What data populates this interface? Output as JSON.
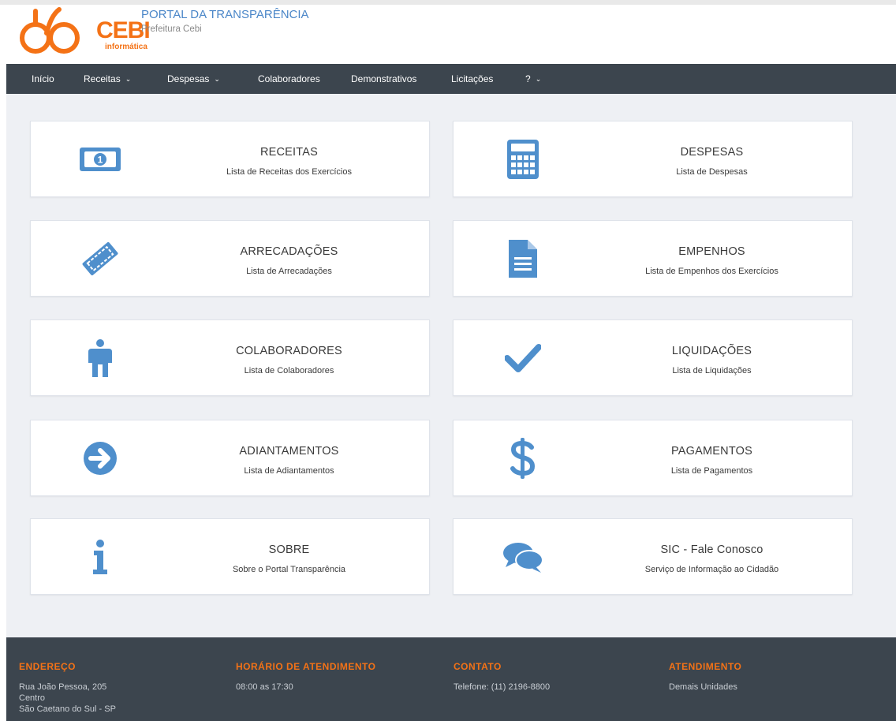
{
  "brand": {
    "logo_text": "CEBI",
    "logo_subtext": "informática",
    "portal_title": "PORTAL DA TRANSPARÊNCIA",
    "portal_subtitle": "Prefeitura Cebi",
    "accent_color": "#f47216",
    "title_color": "#4a86c8"
  },
  "nav": {
    "items": [
      {
        "label": "Início",
        "has_caret": false
      },
      {
        "label": "Receitas",
        "has_caret": true
      },
      {
        "label": "Despesas",
        "has_caret": true
      },
      {
        "label": "Colaboradores",
        "has_caret": false
      },
      {
        "label": "Demonstrativos",
        "has_caret": false
      },
      {
        "label": "Licitações",
        "has_caret": false
      },
      {
        "label": "?",
        "has_caret": true
      }
    ],
    "caret_glyph": "⌄"
  },
  "cards": [
    {
      "icon": "money-bill-icon",
      "title": "RECEITAS",
      "desc": "Lista de Receitas dos Exercícios"
    },
    {
      "icon": "calculator-icon",
      "title": "DESPESAS",
      "desc": "Lista de Despesas"
    },
    {
      "icon": "ticket-icon",
      "title": "ARRECADAÇÕES",
      "desc": "Lista de Arrecadações"
    },
    {
      "icon": "document-icon",
      "title": "EMPENHOS",
      "desc": "Lista de Empenhos dos Exercícios"
    },
    {
      "icon": "person-icon",
      "title": "COLABORADORES",
      "desc": "Lista de Colaboradores"
    },
    {
      "icon": "checkmark-icon",
      "title": "LIQUIDAÇÕES",
      "desc": "Lista de Liquidações"
    },
    {
      "icon": "arrow-circle-right-icon",
      "title": "ADIANTAMENTOS",
      "desc": "Lista de Adiantamentos"
    },
    {
      "icon": "dollar-icon",
      "title": "PAGAMENTOS",
      "desc": "Lista de Pagamentos"
    },
    {
      "icon": "info-icon",
      "title": "SOBRE",
      "desc": "Sobre o Portal Transparência"
    },
    {
      "icon": "chat-bubbles-icon",
      "title": "SIC - Fale Conosco",
      "desc": "Serviço de Informação ao Cidadão"
    }
  ],
  "icon_color": "#4f8fcc",
  "footer": {
    "address": {
      "heading": "ENDEREÇO",
      "lines": [
        "Rua João Pessoa, 205",
        "Centro",
        "São Caetano do Sul - SP"
      ]
    },
    "hours": {
      "heading": "HORÁRIO DE ATENDIMENTO",
      "lines": [
        "08:00 as 17:30"
      ]
    },
    "contact": {
      "heading": "CONTATO",
      "lines": [
        "Telefone: (11) 2196-8800"
      ]
    },
    "service": {
      "heading": "ATENDIMENTO",
      "lines": [
        "Demais Unidades"
      ]
    }
  }
}
